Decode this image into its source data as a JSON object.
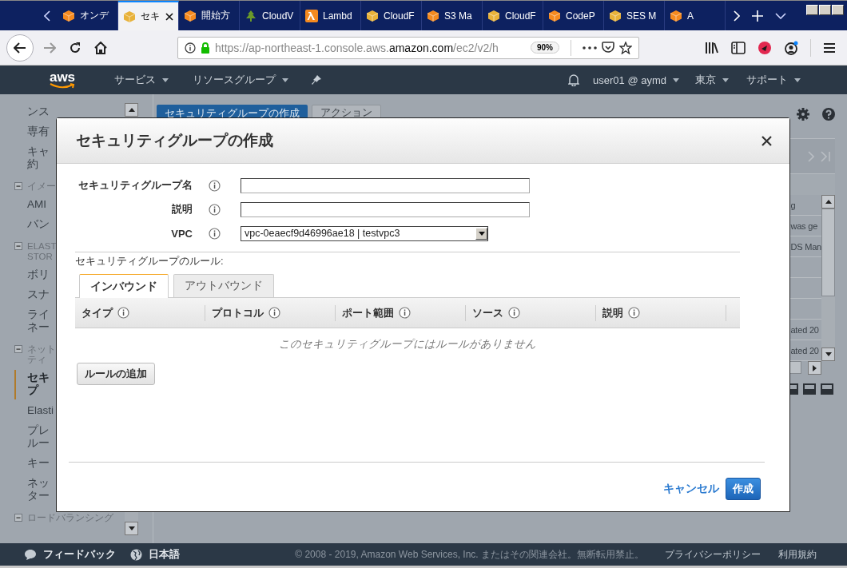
{
  "browser": {
    "tabs": [
      {
        "label": "オンデ",
        "kind": "cube",
        "color": "#f58a1f",
        "selected": false
      },
      {
        "label": "セキ",
        "kind": "cube",
        "color": "#e8b23a",
        "selected": true
      },
      {
        "label": "開始方",
        "kind": "cube",
        "color": "#f58a1f",
        "selected": false
      },
      {
        "label": "CloudV",
        "kind": "plant",
        "color": "#6a9a2a",
        "selected": false
      },
      {
        "label": "Lambd",
        "kind": "lambda",
        "color": "#f58a1f",
        "selected": false
      },
      {
        "label": "CloudF",
        "kind": "cube",
        "color": "#e8b23a",
        "selected": false
      },
      {
        "label": "S3 Ma",
        "kind": "cube",
        "color": "#f58a1f",
        "selected": false
      },
      {
        "label": "CloudF",
        "kind": "cube",
        "color": "#e8b23a",
        "selected": false
      },
      {
        "label": "CodeP",
        "kind": "cube",
        "color": "#f58a1f",
        "selected": false
      },
      {
        "label": "SES M",
        "kind": "cube",
        "color": "#e8b23a",
        "selected": false
      },
      {
        "label": "A",
        "kind": "cube",
        "color": "#f58a1f",
        "selected": false
      }
    ],
    "url": "https://ap-northeast-1.console.aws.**amazon.com**/ec2/v2/h",
    "zoom": "90%"
  },
  "aws_header": {
    "logo": "aws",
    "menus": [
      "サービス",
      "リソースグループ"
    ],
    "user": "user01 @ aymd",
    "region": "東京",
    "support": "サポート"
  },
  "sidebar": {
    "items": [
      {
        "kind": "item",
        "lines": [
          "ンス"
        ],
        "selected": false
      },
      {
        "kind": "item",
        "lines": [
          "専有"
        ],
        "selected": false
      },
      {
        "kind": "item",
        "lines": [
          "キャ",
          "約"
        ],
        "selected": false
      },
      {
        "kind": "section",
        "lines": [
          "イメー"
        ]
      },
      {
        "kind": "item",
        "lines": [
          "AMI"
        ],
        "selected": false
      },
      {
        "kind": "item",
        "lines": [
          "バン"
        ],
        "selected": false
      },
      {
        "kind": "section",
        "lines": [
          "ELAST",
          "STOR"
        ]
      },
      {
        "kind": "item",
        "lines": [
          "ボリ"
        ],
        "selected": false
      },
      {
        "kind": "item",
        "lines": [
          "スナ"
        ],
        "selected": false
      },
      {
        "kind": "item",
        "lines": [
          "ライ",
          "ネー"
        ],
        "selected": false
      },
      {
        "kind": "section",
        "lines": [
          "ネット",
          "ティ"
        ]
      },
      {
        "kind": "item",
        "lines": [
          "セキ",
          "プ"
        ],
        "selected": true
      },
      {
        "kind": "item",
        "lines": [
          "Elasti"
        ],
        "selected": false
      },
      {
        "kind": "item",
        "lines": [
          "プレ",
          "ルー"
        ],
        "selected": false
      },
      {
        "kind": "item",
        "lines": [
          "キー"
        ],
        "selected": false
      },
      {
        "kind": "item",
        "lines": [
          "ネッ",
          "ター"
        ],
        "selected": false
      },
      {
        "kind": "section",
        "lines": [
          "ロードバランシング"
        ]
      }
    ]
  },
  "background": {
    "buttons": [
      "セキュリティグループの作成",
      "アクション"
    ],
    "cells": [
      "g",
      "was ge",
      "DS Man",
      "",
      "",
      "",
      "ated 20",
      "ated 20"
    ]
  },
  "dialog": {
    "title": "セキュリティグループの作成",
    "fields": [
      {
        "kind": "text",
        "label": "セキュリティグループ名"
      },
      {
        "kind": "text",
        "label": "説明"
      },
      {
        "kind": "select",
        "label": "VPC",
        "value": "vpc-0eaecf9d46996ae18 | testvpc3"
      }
    ],
    "rules_label": "セキュリティグループのルール:",
    "tabs": [
      {
        "label": "インバウンド",
        "selected": true
      },
      {
        "label": "アウトバウンド",
        "selected": false
      }
    ],
    "columns": [
      "タイプ",
      "プロトコル",
      "ポート範囲",
      "ソース",
      "説明"
    ],
    "empty_message": "このセキュリティグループにはルールがありません",
    "add_button": "ルールの追加",
    "cancel": "キャンセル",
    "create": "作成"
  },
  "footer": {
    "feedback": "フィードバック",
    "language": "日本語",
    "copyright": "© 2008 - 2019, Amazon Web Services, Inc. またはその関連会社。無断転用禁止。",
    "privacy": "プライバシーポリシー",
    "terms": "利用規約"
  }
}
